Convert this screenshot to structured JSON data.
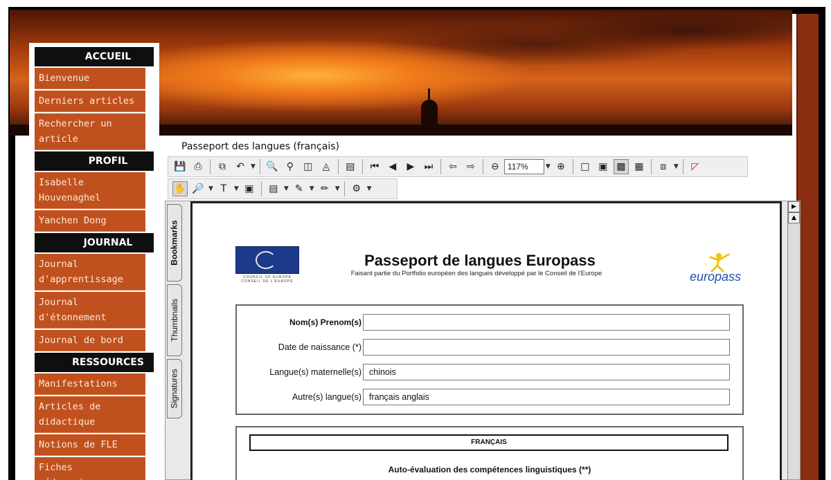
{
  "nav": {
    "sections": [
      {
        "header": "ACCUEIL",
        "items": [
          "Bienvenue",
          "Derniers articles",
          "Rechercher un article"
        ]
      },
      {
        "header": "PROFIL",
        "items": [
          "Isabelle Houvenaghel",
          "Yanchen Dong"
        ]
      },
      {
        "header": "JOURNAL",
        "items": [
          "Journal d'apprentissage",
          "Journal d'étonnement",
          "Journal de bord"
        ]
      },
      {
        "header": "RESSOURCES",
        "items": [
          "Manifestations",
          "Articles de didactique",
          "Notions de FLE",
          "Fiches pédagogiques"
        ]
      }
    ]
  },
  "document": {
    "title": "Passeport des langues (français)"
  },
  "toolbar": {
    "zoom": "117%"
  },
  "viewer": {
    "tabs": [
      "Bookmarks",
      "Thumbnails",
      "Signatures"
    ]
  },
  "pdf": {
    "title": "Passeport de langues Europass",
    "subtitle": "Faisant partie du Portfolio européen des langues développé par le Conseil de l'Europe",
    "eu_caption": "COUNCIL OF EUROPE   CONSEIL DE L'EUROPE",
    "europass_logo_text": "europass",
    "form": [
      {
        "label": "Nom(s) Prenom(s)",
        "value": ""
      },
      {
        "label": "Date de naissance (*)",
        "value": ""
      },
      {
        "label": "Langue(s) maternelle(s)",
        "value": "chinois"
      },
      {
        "label": "Autre(s) langue(s)",
        "value": "français anglais"
      }
    ],
    "language_header": "FRANÇAIS",
    "self_eval": "Auto-évaluation des compétences linguistiques (**)"
  },
  "colors": {
    "nav_item_bg": "#c0511e",
    "nav_header_bg": "#0f0f0f",
    "frame": "#000000"
  }
}
